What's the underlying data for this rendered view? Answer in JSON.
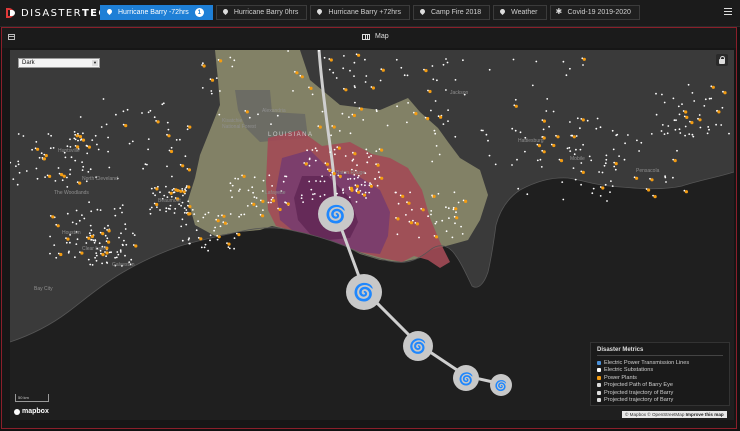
{
  "brand": {
    "name_light": "DISASTER",
    "name_bold": "TECH"
  },
  "tabs": [
    {
      "label": "Hurricane Barry -72hrs",
      "icon": "map-marker-icon",
      "active": true,
      "badge": "1"
    },
    {
      "label": "Hurricane Barry 0hrs",
      "icon": "map-marker-icon",
      "active": false
    },
    {
      "label": "Hurricane Barry +72hrs",
      "icon": "map-marker-icon",
      "active": false
    },
    {
      "label": "Camp Fire 2018",
      "icon": "map-marker-icon",
      "active": false
    },
    {
      "label": "Weather",
      "icon": "map-marker-icon",
      "active": false
    },
    {
      "label": "Covid-19 2019-2020",
      "icon": "virus-icon",
      "active": false
    }
  ],
  "panel": {
    "title": "Map"
  },
  "map": {
    "style_select": "Dark",
    "scale": "50 km",
    "logo": "mapbox",
    "attribution": {
      "text": "© Mapbox © OpenStreetMap",
      "link": "Improve this map"
    },
    "places": {
      "state": "LOUISIANA",
      "alexandria": "Alexandria",
      "kisatchie": "Kisatchie National Forest",
      "baton_rouge": "Baton Rouge",
      "lafayette": "Lafayette",
      "houston": "Houston",
      "galveston": "Galveston",
      "woodlands": "The Woodlands",
      "beaumont": "Beaumont",
      "north_cleveland": "North Cleveland",
      "huntsville": "Huntsville",
      "clear_lake": "Clear Lake",
      "bay_city": "Bay City",
      "jackson": "Jackson",
      "hattiesburg": "Hattiesburg",
      "mobile": "Mobile",
      "pensacola": "Pensacola"
    }
  },
  "legend": {
    "title": "Disaster Metrics",
    "items": [
      {
        "label": "Electric Power Transmission Lines",
        "color": "#4a90d9"
      },
      {
        "label": "Electric Substations",
        "color": "#ffffff"
      },
      {
        "label": "Power Plants",
        "color": "#f39c12"
      },
      {
        "label": "Projected Path of Barry Eye",
        "color": "#dddddd"
      },
      {
        "label": "Projected trajectory of Barry",
        "color": "#dddddd"
      },
      {
        "label": "Projected trajectory of Barry",
        "color": "#dddddd"
      }
    ]
  },
  "colors": {
    "accent": "#1e7fd6",
    "panel_border": "#8a1f2a",
    "land_dark": "#3a3a3a",
    "water": "#1f1f1f",
    "zone_outer": "#8f8e6e",
    "zone_mid": "#6f6f66",
    "zone_red": "#a24a55",
    "zone_purple": "#7a3d6e",
    "zone_inner": "#6a2a5a",
    "substation": "#ffffff",
    "power_plant": "#f39c12"
  },
  "hurricane_markers": [
    "hurricane-icon",
    "hurricane-icon",
    "hurricane-icon",
    "hurricane-icon",
    "hurricane-icon"
  ]
}
